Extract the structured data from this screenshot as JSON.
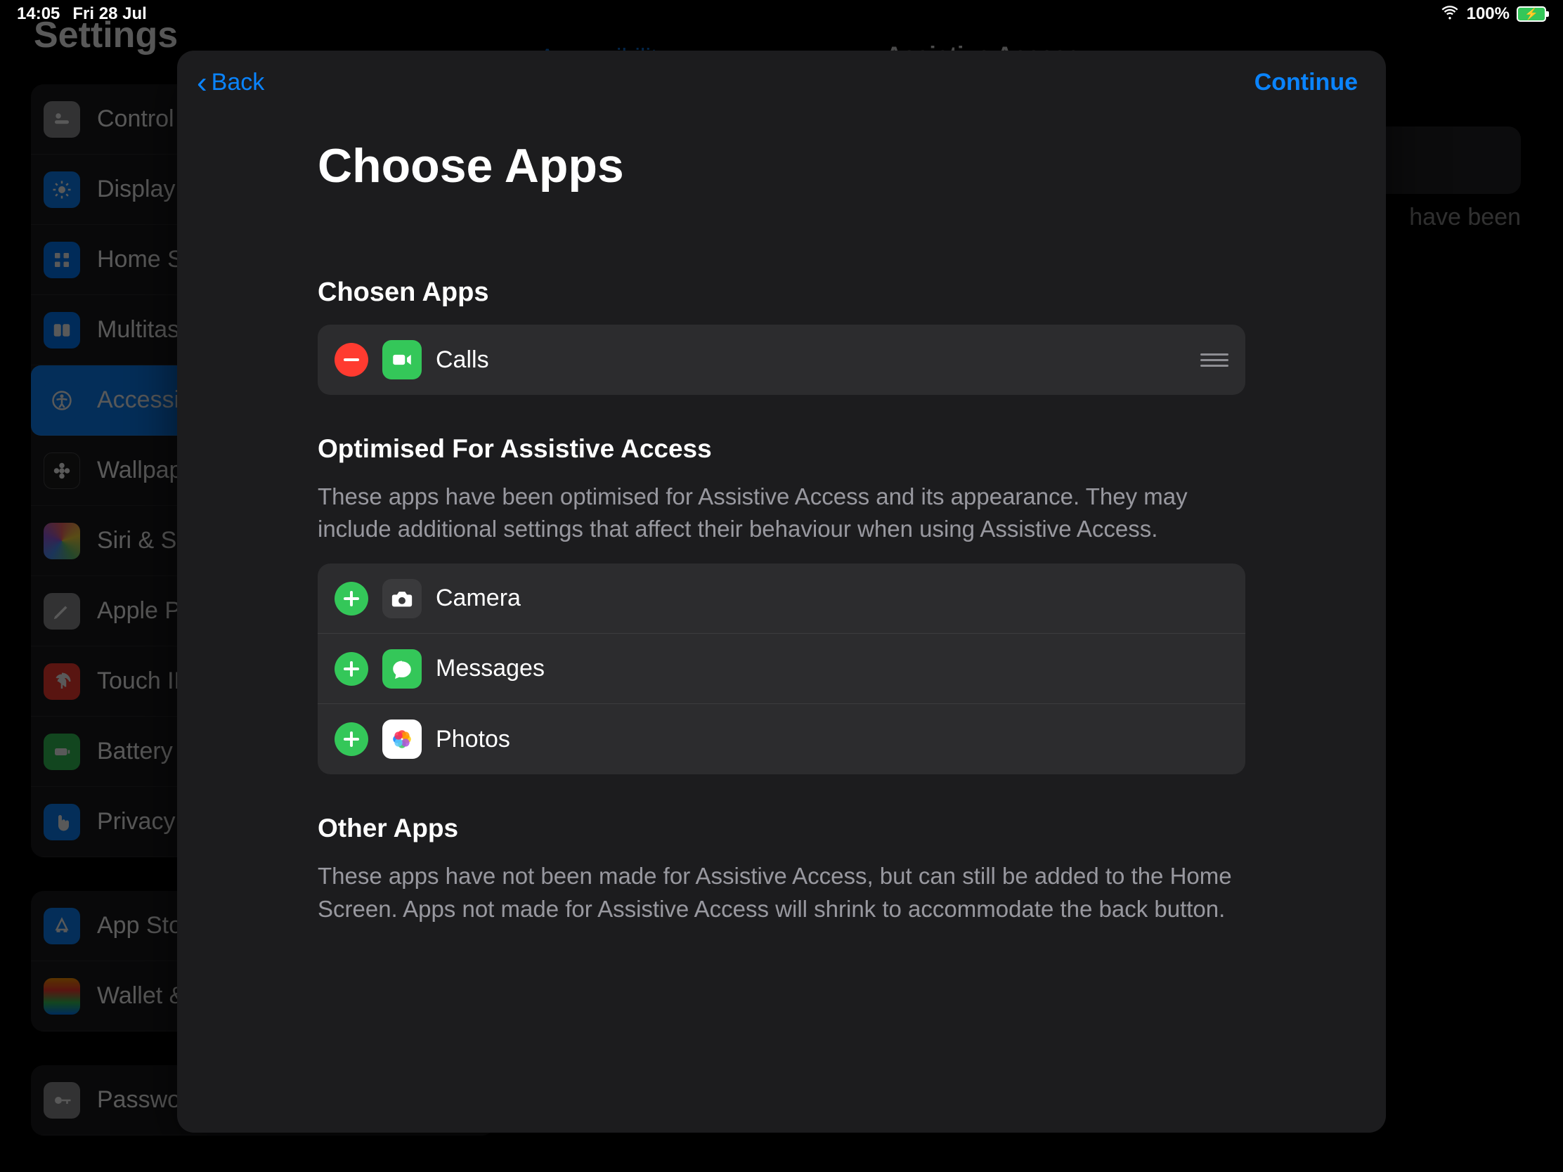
{
  "status": {
    "time": "14:05",
    "date": "Fri 28 Jul",
    "battery_pct": "100%"
  },
  "background": {
    "settings_title": "Settings",
    "detail_back": "Accessibility",
    "detail_title": "Assistive Access",
    "right_text_fragment": "have been",
    "sidebar": [
      {
        "label": "Control Centre",
        "icon": "control"
      },
      {
        "label": "Display & Brightness",
        "icon": "display"
      },
      {
        "label": "Home Screen & App Library",
        "icon": "home"
      },
      {
        "label": "Multitasking & Gestures",
        "icon": "multitask"
      },
      {
        "label": "Accessibility",
        "icon": "accessibility",
        "active": true
      },
      {
        "label": "Wallpaper",
        "icon": "wallpaper"
      },
      {
        "label": "Siri & Search",
        "icon": "siri"
      },
      {
        "label": "Apple Pencil",
        "icon": "pencil"
      },
      {
        "label": "Touch ID & Passcode",
        "icon": "touchid"
      },
      {
        "label": "Battery",
        "icon": "battery"
      },
      {
        "label": "Privacy & Security",
        "icon": "privacy"
      }
    ],
    "sidebar2": [
      {
        "label": "App Store",
        "icon": "appstore"
      },
      {
        "label": "Wallet & Apple Pay",
        "icon": "wallet"
      }
    ],
    "sidebar3_label": "Passwords"
  },
  "modal": {
    "back_label": "Back",
    "continue_label": "Continue",
    "title": "Choose Apps",
    "sections": {
      "chosen": {
        "header": "Chosen Apps",
        "items": [
          {
            "name": "Calls",
            "icon": "facetime"
          }
        ]
      },
      "optimised": {
        "header": "Optimised For Assistive Access",
        "description": "These apps have been optimised for Assistive Access and its appearance. They may include additional settings that affect their behaviour when using Assistive Access.",
        "items": [
          {
            "name": "Camera",
            "icon": "camera"
          },
          {
            "name": "Messages",
            "icon": "messages"
          },
          {
            "name": "Photos",
            "icon": "photos"
          }
        ]
      },
      "other": {
        "header": "Other Apps",
        "description": "These apps have not been made for Assistive Access, but can still be added to the Home Screen. Apps not made for Assistive Access will shrink to accommodate the back button."
      }
    }
  }
}
